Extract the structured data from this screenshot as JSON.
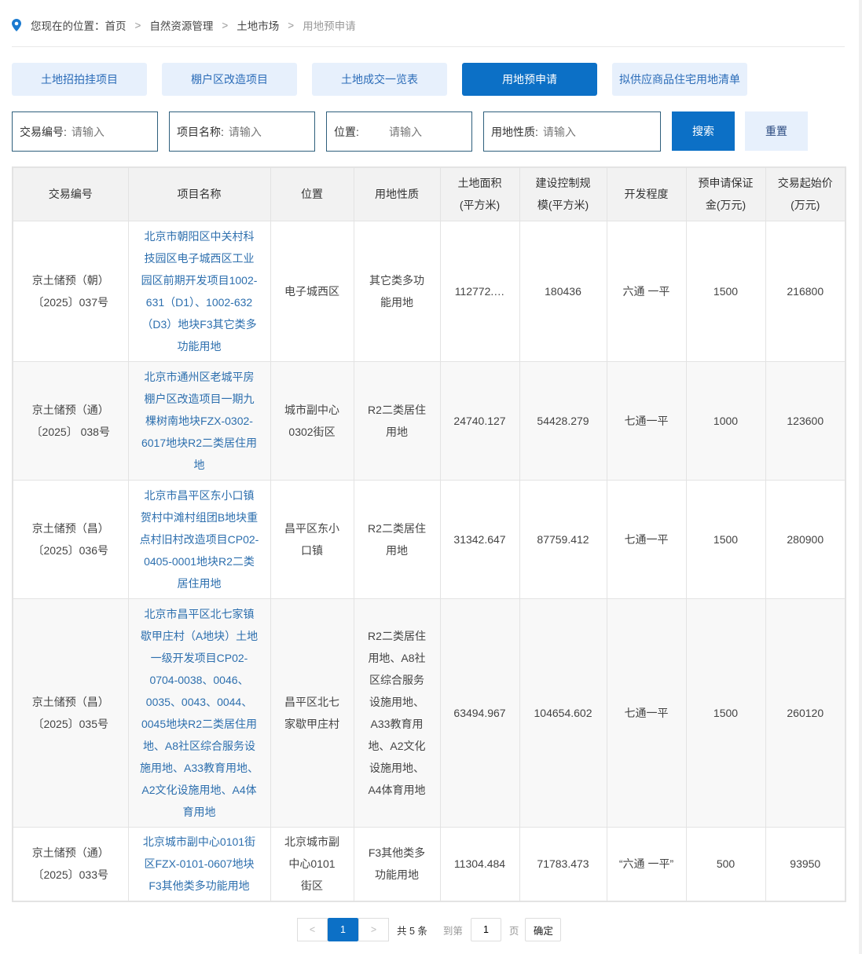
{
  "breadcrumb": {
    "prefix": "您现在的位置：",
    "items": [
      "首页",
      "自然资源管理",
      "土地市场"
    ],
    "current": "用地预申请",
    "sep": ">"
  },
  "tabs": [
    {
      "label": "土地招拍挂项目"
    },
    {
      "label": "棚户区改造项目"
    },
    {
      "label": "土地成交一览表"
    },
    {
      "label": "用地预申请",
      "active": true
    },
    {
      "label": "拟供应商品住宅用地清单"
    }
  ],
  "filters": [
    {
      "label": "交易编号:",
      "placeholder": "请输入"
    },
    {
      "label": "项目名称:",
      "placeholder": "请输入"
    },
    {
      "label": "位置:",
      "placeholder": "请输入"
    },
    {
      "label": "用地性质:",
      "placeholder": "请输入"
    }
  ],
  "buttons": {
    "search": "搜索",
    "reset": "重置"
  },
  "table": {
    "headers": [
      "交易编号",
      "项目名称",
      "位置",
      "用地性质",
      "土地面积(平方米)",
      "建设控制规模(平方米)",
      "开发程度",
      "预申请保证金(万元)",
      "交易起始价(万元)"
    ],
    "rows": [
      [
        "京土储预（朝）〔2025〕037号",
        "北京市朝阳区中关村科技园区电子城西区工业园区前期开发项目1002-631（D1）、1002-632（D3）地块F3其它类多功能用地",
        "电子城西区",
        "其它类多功能用地",
        "112772.…",
        "180436",
        "六通 一平",
        "1500",
        "216800"
      ],
      [
        "京土储预（通）〔2025〕 038号",
        "北京市通州区老城平房棚户区改造项目一期九棵树南地块FZX-0302-6017地块R2二类居住用地",
        "城市副中心0302街区",
        "R2二类居住用地",
        "24740.127",
        "54428.279",
        "七通一平",
        "1000",
        "123600"
      ],
      [
        "京土储预（昌）〔2025〕036号",
        "北京市昌平区东小口镇贺村中滩村组团B地块重点村旧村改造项目CP02-0405-0001地块R2二类居住用地",
        "昌平区东小口镇",
        "R2二类居住用地",
        "31342.647",
        "87759.412",
        "七通一平",
        "1500",
        "280900"
      ],
      [
        "京土储预（昌）〔2025〕035号",
        "北京市昌平区北七家镇歇甲庄村（A地块）土地一级开发项目CP02-0704-0038、0046、0035、0043、0044、0045地块R2二类居住用地、A8社区综合服务设施用地、A33教育用地、A2文化设施用地、A4体育用地",
        "昌平区北七家歇甲庄村",
        "R2二类居住用地、A8社区综合服务设施用地、A33教育用地、A2文化设施用地、A4体育用地",
        "63494.967",
        "104654.602",
        "七通一平",
        "1500",
        "260120"
      ],
      [
        "京土储预（通）〔2025〕033号",
        "北京城市副中心0101街区FZX-0101-0607地块F3其他类多功能用地",
        "北京城市副中心0101街区",
        "F3其他类多功能用地",
        "11304.484",
        "71783.473",
        "“六通 一平”",
        "500",
        "93950"
      ]
    ]
  },
  "pagination": {
    "prev": "<",
    "current": "1",
    "next": ">",
    "total": "共 5 条",
    "goto": "到第",
    "page_value": "1",
    "page_unit": "页",
    "confirm": "确定"
  },
  "colors": {
    "accent": "#0c70c6",
    "tab_bg": "#e7f0fc",
    "link": "#2d6fae"
  }
}
